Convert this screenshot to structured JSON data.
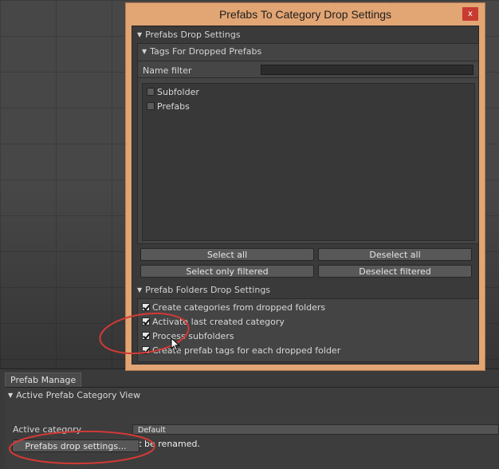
{
  "window": {
    "title": "Prefabs To Category Drop Settings",
    "close_label": "x",
    "accent_color": "#e2a574"
  },
  "drop_settings": {
    "header": "Prefabs Drop Settings",
    "tags_header": "Tags For Dropped Prefabs",
    "name_filter_label": "Name filter",
    "name_filter_value": "",
    "tags": [
      {
        "label": "Subfolder",
        "checked": false
      },
      {
        "label": "Prefabs",
        "checked": false
      }
    ],
    "buttons": {
      "select_all": "Select all",
      "deselect_all": "Deselect all",
      "select_filtered": "Select only filtered",
      "deselect_filtered": "Deselect filtered"
    },
    "folders_header": "Prefab Folders Drop Settings",
    "folder_options": [
      {
        "label": "Create categories from dropped folders",
        "checked": true
      },
      {
        "label": "Activate last created category",
        "checked": true
      },
      {
        "label": "Process subfolders",
        "checked": true
      },
      {
        "label": "Create prefab tags for each dropped folder",
        "checked": true
      }
    ]
  },
  "inspector": {
    "tab_label": "Prefab Manage",
    "fold_header": "Active Prefab Category View",
    "active_category_label": "Active category",
    "active_category_value": "Default",
    "note": "The default category can not be renamed.",
    "drop_settings_button": "Prefabs drop settings..."
  },
  "annotation_color": "#d33a36"
}
